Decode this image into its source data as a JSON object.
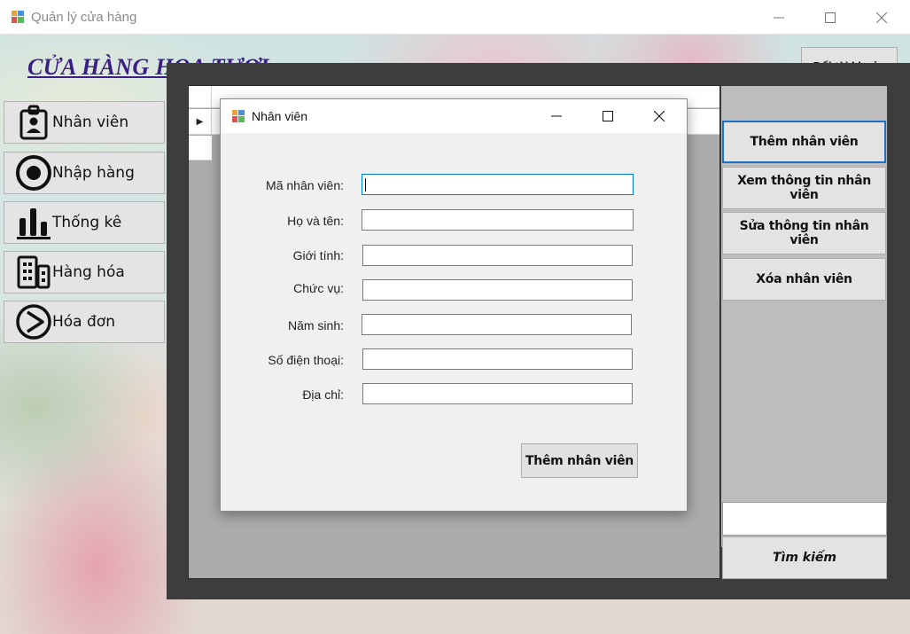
{
  "window": {
    "title": "Quản lý cửa hàng",
    "icon": "app-window-icon"
  },
  "header": {
    "store_title": "CỬA HÀNG HOA TƯƠI",
    "switch_account": "Đổi tài khoản"
  },
  "sidebar": {
    "items": [
      {
        "label": "Nhân viên",
        "icon": "employee-badge-icon"
      },
      {
        "label": "Nhập hàng",
        "icon": "target-icon"
      },
      {
        "label": "Thống kê",
        "icon": "bar-chart-icon"
      },
      {
        "label": "Hàng hóa",
        "icon": "buildings-icon"
      },
      {
        "label": "Hóa đơn",
        "icon": "pie-chart-icon"
      }
    ]
  },
  "grid": {
    "row_indicator": "▶"
  },
  "actions": {
    "add": "Thêm nhân viên",
    "view": "Xem thông tin nhân viên",
    "edit": "Sửa thông tin nhân viên",
    "delete": "Xóa nhân viên",
    "search_value": "",
    "search": "Tìm kiếm"
  },
  "dialog": {
    "title": "Nhân viên",
    "fields": [
      {
        "label": "Mã nhân viên:",
        "value": ""
      },
      {
        "label": "Họ và tên:",
        "value": ""
      },
      {
        "label": "Giới tính:",
        "value": ""
      },
      {
        "label": "Chức vụ:",
        "value": ""
      },
      {
        "label": "Năm sinh:",
        "value": ""
      },
      {
        "label": "Số điện thoại:",
        "value": ""
      },
      {
        "label": "Địa chỉ:",
        "value": ""
      }
    ],
    "submit": "Thêm nhân viên"
  },
  "colors": {
    "store_title": "#3b1e84",
    "active_border": "#1a73c9",
    "panel_dark": "#3d3d3d"
  }
}
